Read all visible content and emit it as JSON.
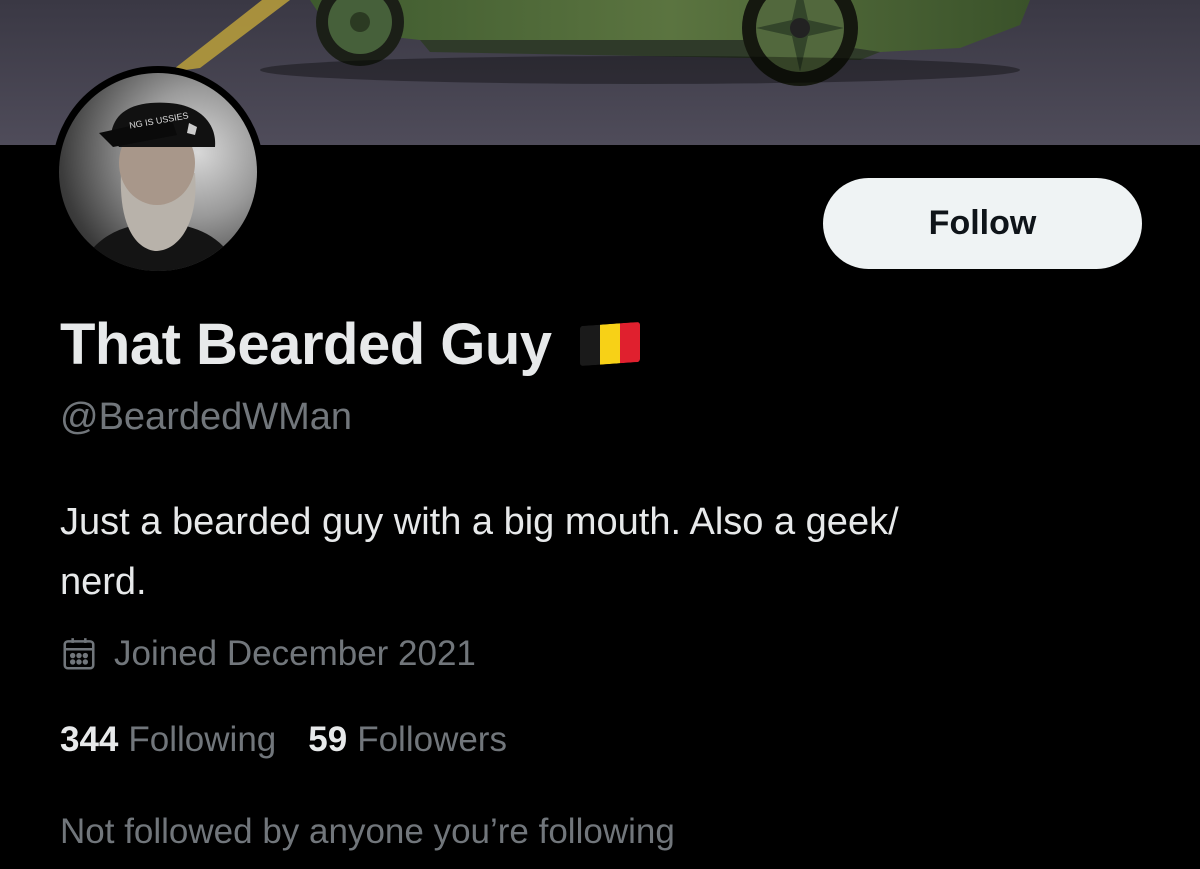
{
  "profile": {
    "display_name": "That Bearded Guy",
    "handle": "@BeardedWMan",
    "bio": "Just a bearded guy with a big mouth. Also a geek/\nnerd.",
    "joined": "Joined December 2021",
    "following_count": "344",
    "following_label": "Following",
    "followers_count": "59",
    "followers_label": "Followers",
    "mutual_note": "Not followed by anyone you’re following",
    "cap_text": "NG IS USSIES",
    "name_emoji": "belgium-flag"
  },
  "actions": {
    "follow_label": "Follow"
  },
  "colors": {
    "background": "#000000",
    "primary_text": "#e7e9ea",
    "secondary_text": "#71767b",
    "follow_button_bg": "#eff3f4",
    "follow_button_text": "#0f1419",
    "flag_black": "#1a1a1a",
    "flag_yellow": "#f7d117",
    "flag_red": "#e0202e"
  },
  "icons": {
    "calendar": "calendar-icon"
  }
}
